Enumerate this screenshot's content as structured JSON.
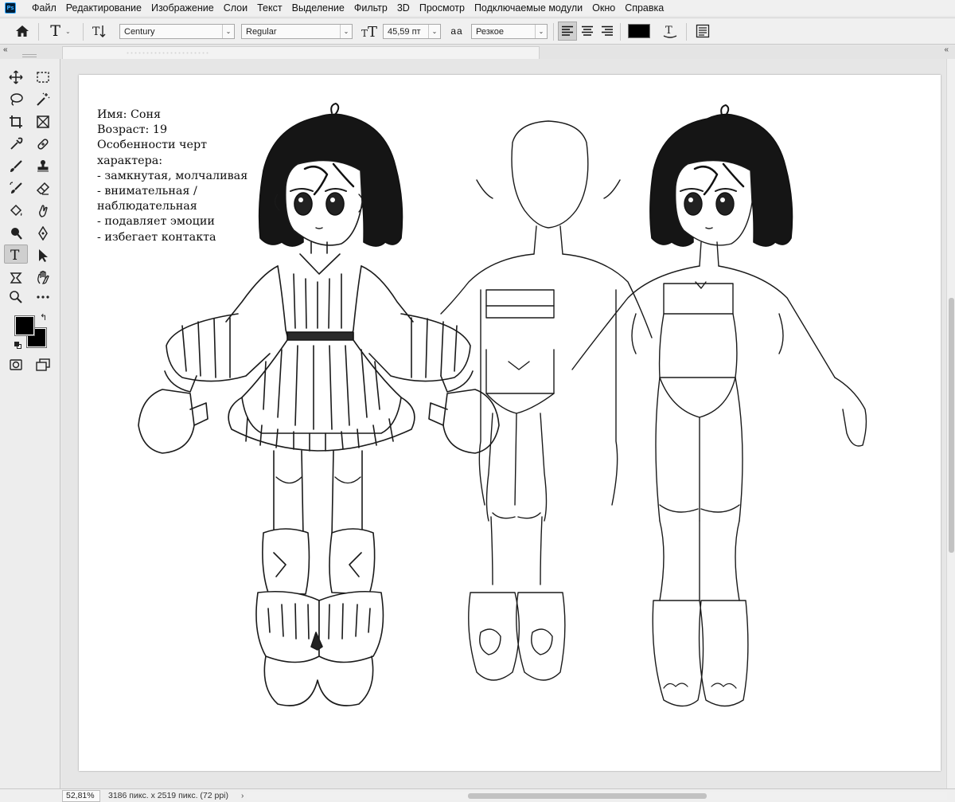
{
  "app": {
    "logo": "Ps"
  },
  "menu": [
    "Файл",
    "Редактирование",
    "Изображение",
    "Слои",
    "Текст",
    "Выделение",
    "Фильтр",
    "3D",
    "Просмотр",
    "Подключаемые модули",
    "Окно",
    "Справка"
  ],
  "options": {
    "font_family": "Century",
    "font_style": "Regular",
    "font_size": "45,59 пт",
    "antialias_icon": "aa",
    "antialias": "Резкое",
    "text_color": "#000000"
  },
  "tools": [
    {
      "icon": "move-icon"
    },
    {
      "icon": "marquee-icon"
    },
    {
      "icon": "lasso-icon"
    },
    {
      "icon": "magic-wand-icon"
    },
    {
      "icon": "crop-icon"
    },
    {
      "icon": "frame-icon"
    },
    {
      "icon": "eyedropper-icon"
    },
    {
      "icon": "healing-icon"
    },
    {
      "icon": "brush-icon"
    },
    {
      "icon": "stamp-icon"
    },
    {
      "icon": "history-brush-icon"
    },
    {
      "icon": "eraser-icon"
    },
    {
      "icon": "bucket-icon"
    },
    {
      "icon": "smudge-icon"
    },
    {
      "icon": "dodge-icon"
    },
    {
      "icon": "pen-icon"
    },
    {
      "icon": "type-icon"
    },
    {
      "icon": "path-select-icon"
    },
    {
      "icon": "shape-icon"
    },
    {
      "icon": "hand-icon"
    },
    {
      "icon": "zoom-icon"
    },
    {
      "icon": "more-tools-icon"
    }
  ],
  "colors": {
    "foreground": "#000000",
    "background": "#000000"
  },
  "canvas": {
    "lines": [
      "Имя: Соня",
      "Возраст: 19",
      "Особенности черт",
      "характера:",
      "- замкнутая, молчаливая",
      "- внимательная /",
      "наблюдательная",
      "- подавляет эмоции",
      "- избегает контакта"
    ]
  },
  "status": {
    "zoom": "52,81%",
    "doc_info": "3186 пикс. x 2519 пикс. (72 ppi)",
    "arrow": "›"
  }
}
